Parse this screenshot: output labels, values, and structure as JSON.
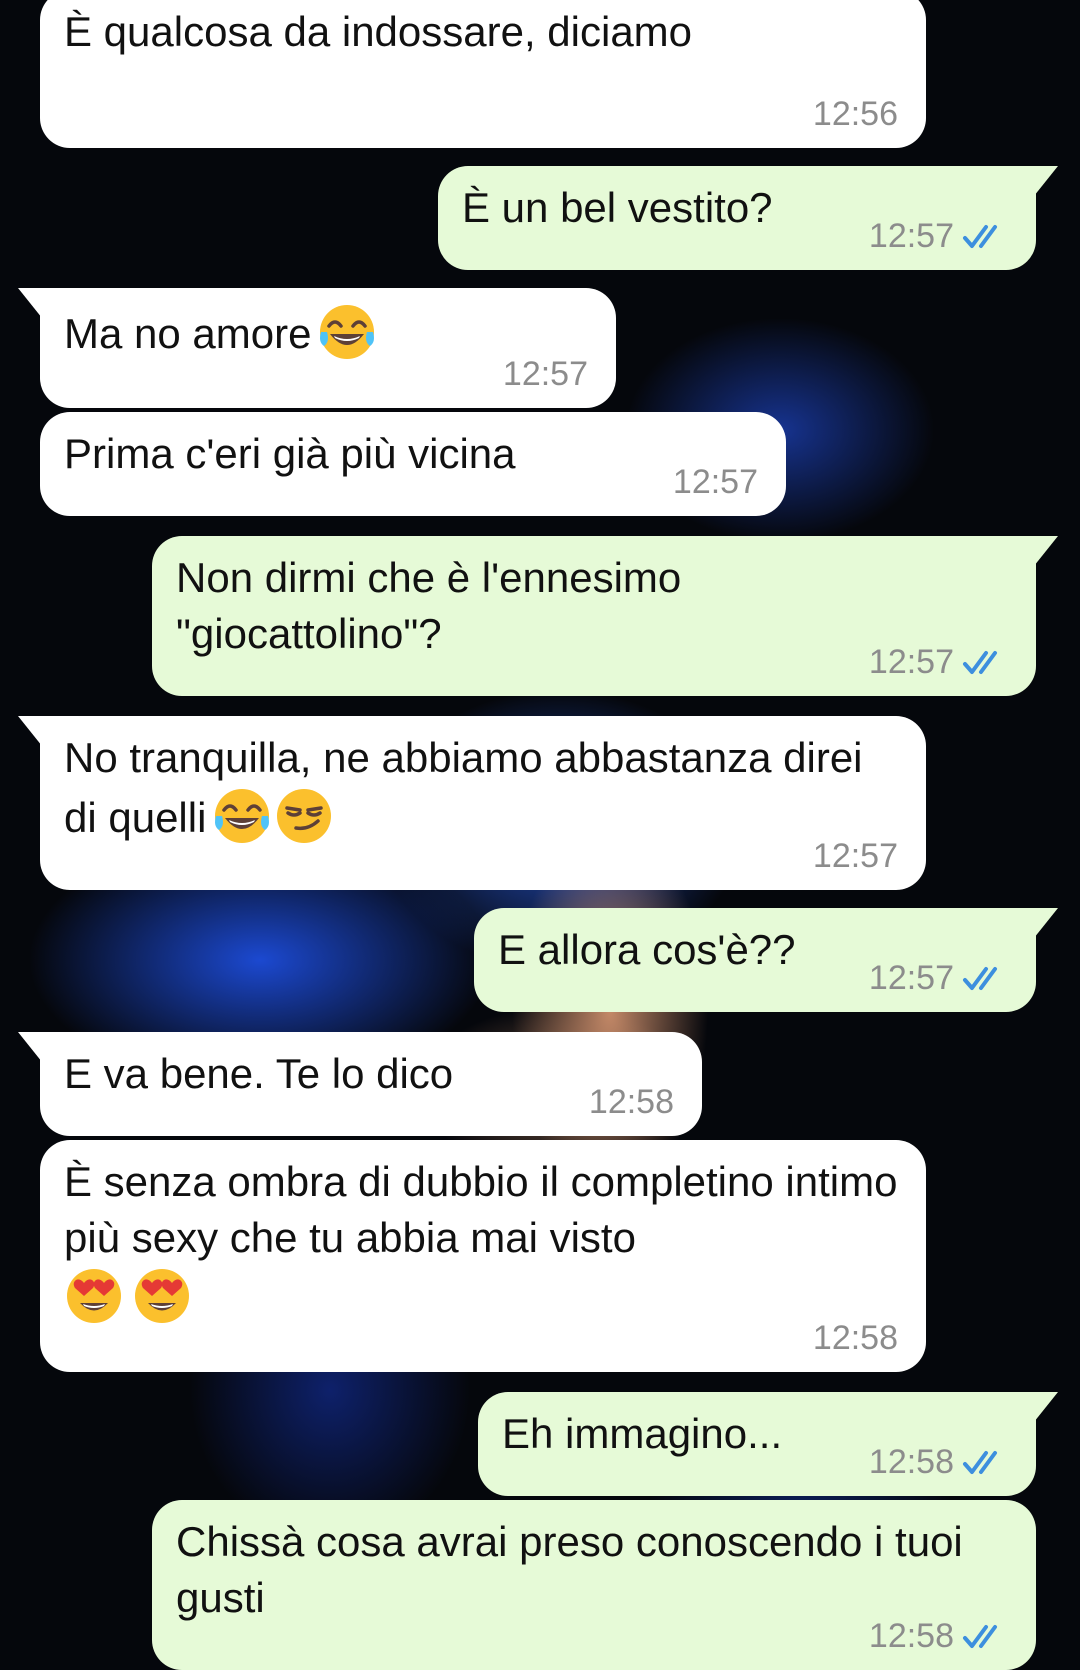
{
  "colors": {
    "incoming_bubble": "#ffffff",
    "outgoing_bubble": "#e6fad7",
    "read_ticks": "#3d8fde",
    "timestamp": "#8c8c8c"
  },
  "messages": [
    {
      "direction": "incoming",
      "text": "È qualcosa da indossare, diciamo",
      "time": "12:56"
    },
    {
      "direction": "outgoing",
      "text": "È un bel vestito?",
      "time": "12:57",
      "status": "read"
    },
    {
      "direction": "incoming",
      "text": "Ma no amore",
      "emojis": [
        "tears-of-joy-emoji"
      ],
      "time": "12:57"
    },
    {
      "direction": "incoming",
      "text": "Prima c'eri già più vicina",
      "time": "12:57"
    },
    {
      "direction": "outgoing",
      "text": "Non dirmi che è l'ennesimo \"giocattolino\"?",
      "time": "12:57",
      "status": "read"
    },
    {
      "direction": "incoming",
      "text": "No tranquilla, ne abbiamo abbastanza direi di quelli",
      "emojis": [
        "tears-of-joy-emoji",
        "smirk-emoji"
      ],
      "time": "12:57"
    },
    {
      "direction": "outgoing",
      "text": "E allora cos'è??",
      "time": "12:57",
      "status": "read"
    },
    {
      "direction": "incoming",
      "text": "E va bene. Te lo dico",
      "time": "12:58"
    },
    {
      "direction": "incoming",
      "text": "È senza ombra di dubbio il completino intimo più sexy che tu abbia mai visto",
      "emojis": [
        "heart-eyes-emoji",
        "heart-eyes-emoji"
      ],
      "time": "12:58"
    },
    {
      "direction": "outgoing",
      "text": "Eh immagino...",
      "time": "12:58",
      "status": "read"
    },
    {
      "direction": "outgoing",
      "text": "Chissà cosa avrai preso conoscendo i tuoi gusti",
      "time": "12:58",
      "status": "read"
    }
  ]
}
